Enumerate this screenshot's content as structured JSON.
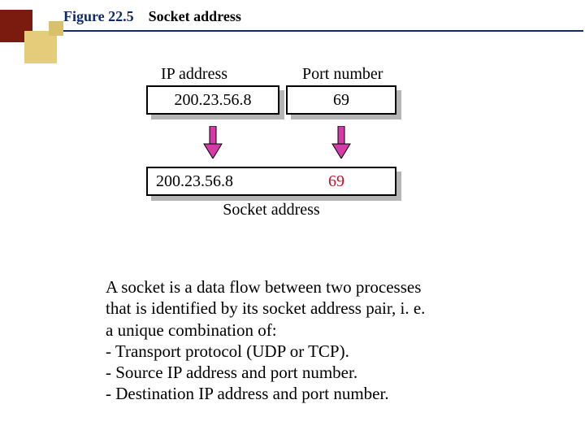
{
  "header": {
    "figure_no": "Figure 22.5",
    "title": "Socket address"
  },
  "diagram": {
    "labels": {
      "ip": "IP address",
      "port": "Port number",
      "socket": "Socket address"
    },
    "values": {
      "ip": "200.23.56.8",
      "port": "69",
      "combined_ip": "200.23.56.8",
      "combined_port": "69"
    },
    "colors": {
      "port_highlight": "#c0152b",
      "arrow_fill": "#d63aa8"
    }
  },
  "body": {
    "line1": "A socket is a data flow between two processes",
    "line2": "that is identified by its socket address pair, i. e.",
    "line3": "a unique combination of:",
    "line4": "- Transport protocol (UDP or TCP).",
    "line5": "- Source IP address and port number.",
    "line6": "- Destination IP address and port number."
  }
}
